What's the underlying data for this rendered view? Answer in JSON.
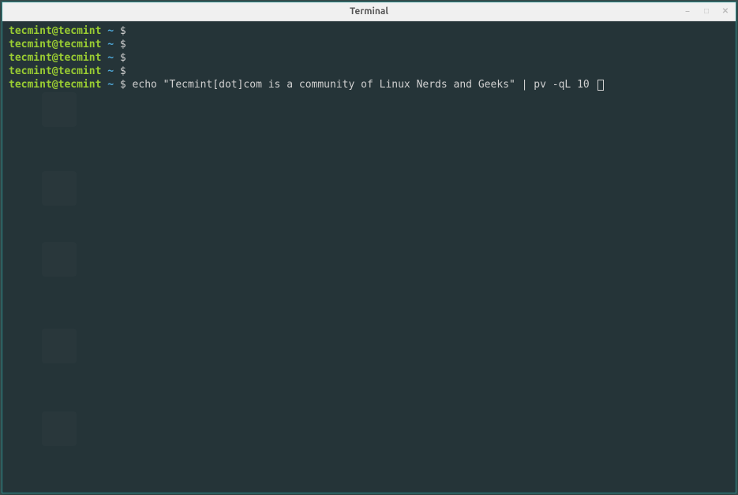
{
  "window": {
    "title": "Terminal"
  },
  "prompt": {
    "user_host": "tecmint@tecmint",
    "path": "~",
    "symbol": "$"
  },
  "lines": [
    {
      "command": ""
    },
    {
      "command": ""
    },
    {
      "command": ""
    },
    {
      "command": ""
    },
    {
      "command": "echo \"Tecmint[dot]com is a community of Linux Nerds and Geeks\" | pv -qL 10 "
    }
  ],
  "controls": {
    "minimize": "–",
    "maximize": "□",
    "close": "✕"
  }
}
